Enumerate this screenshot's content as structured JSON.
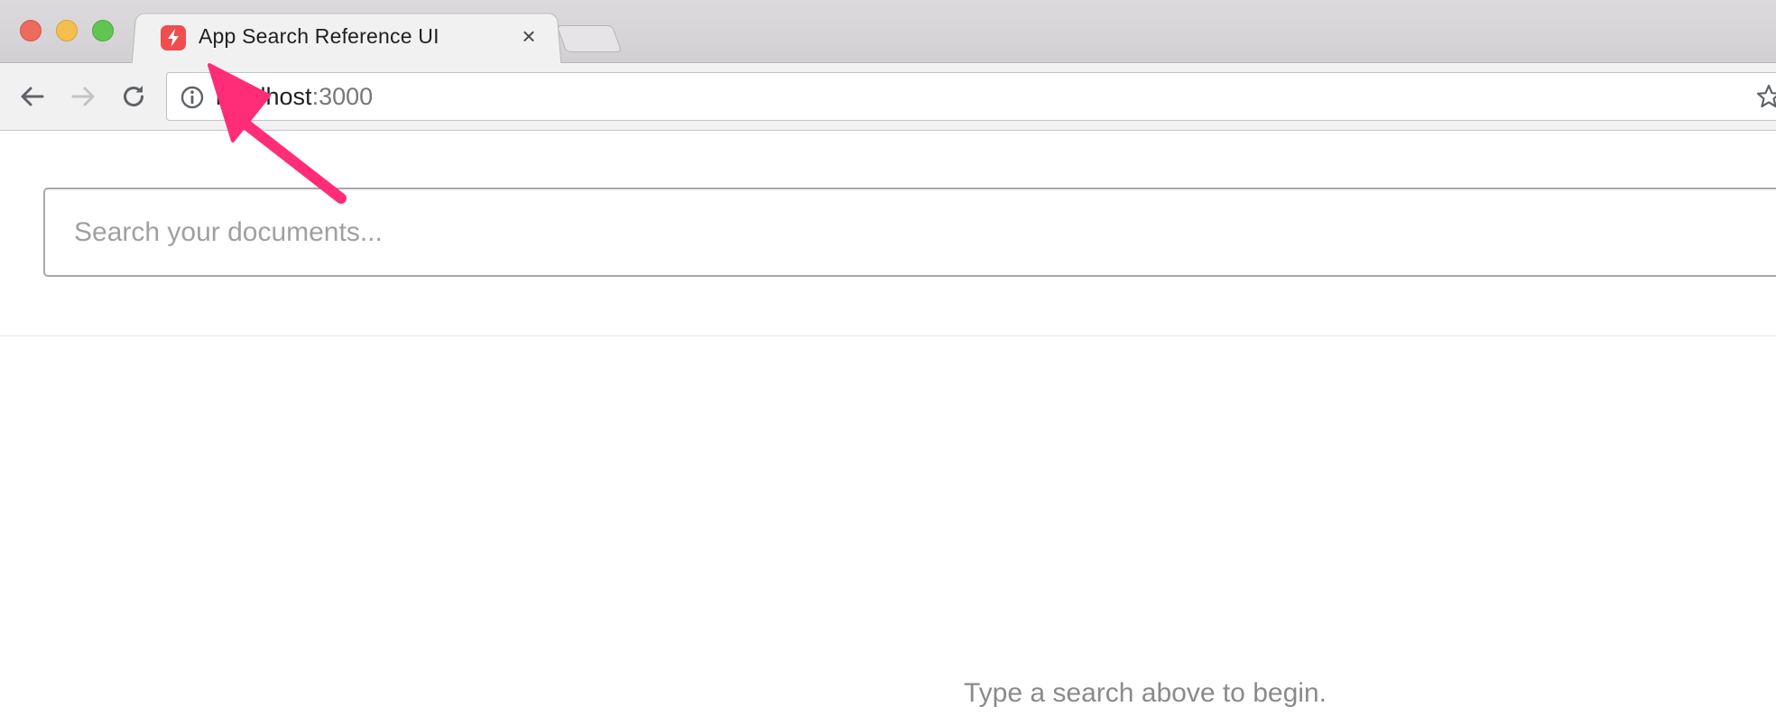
{
  "browser": {
    "tab": {
      "title": "App Search Reference UI",
      "close_glyph": "×",
      "favicon": "lightning-bolt-icon"
    },
    "toolbar": {
      "back": "arrow-left-icon",
      "forward": "arrow-right-icon",
      "reload": "reload-icon"
    },
    "address_bar": {
      "host": "localhost",
      "port": ":3000",
      "site_info": "info-icon",
      "bookmark": "star-icon"
    }
  },
  "page": {
    "search": {
      "placeholder": "Search your documents...",
      "value": ""
    },
    "empty_state": "Type a search above to begin."
  },
  "colors": {
    "favicon_bg": "#f04e4e",
    "annotation_arrow": "#ff2d78",
    "traffic_close": "#ed6a5e",
    "traffic_minimize": "#f5bf4f",
    "traffic_zoom": "#61c554"
  }
}
